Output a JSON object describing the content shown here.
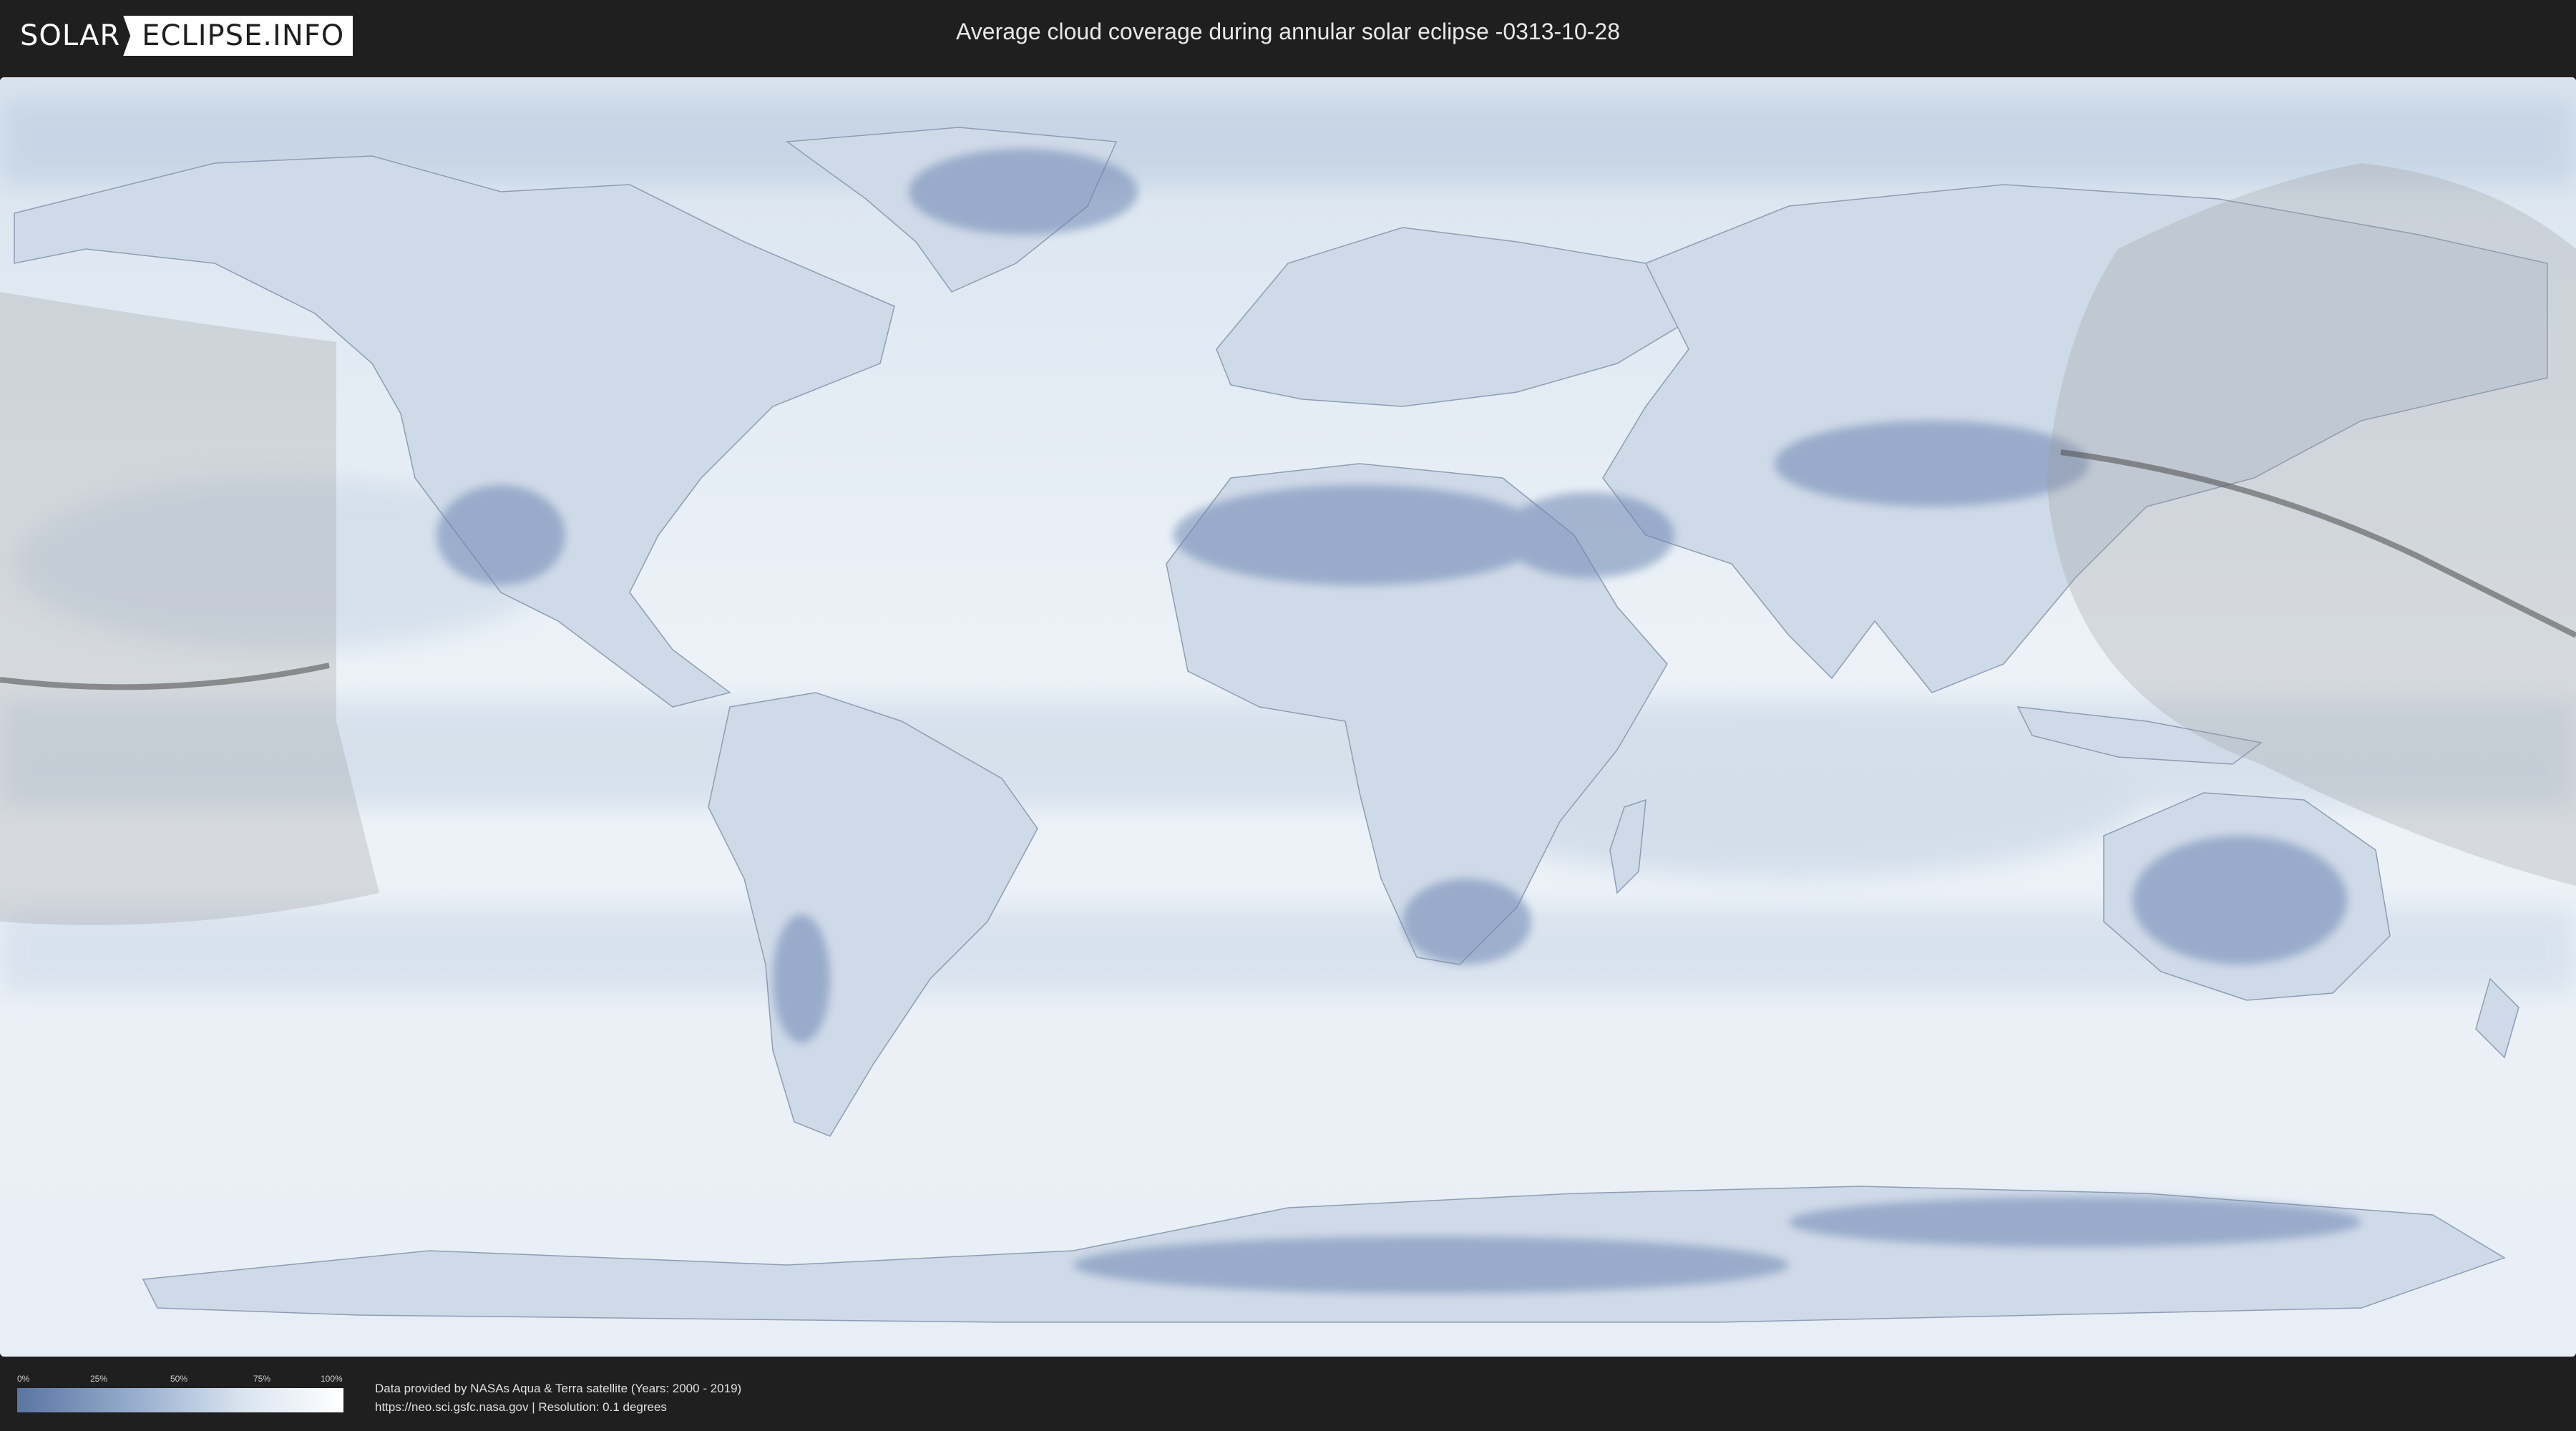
{
  "header": {
    "logo_left": "SOLAR",
    "logo_right": "ECLIPSE.INFO",
    "title": "Average cloud coverage during annular solar eclipse -0313-10-28"
  },
  "legend": {
    "ticks": [
      "0%",
      "25%",
      "50%",
      "75%",
      "100%"
    ],
    "colors": {
      "low": "#5a74a3",
      "high": "#ffffff"
    }
  },
  "credits": {
    "line1": "Data provided by NASAs Aqua & Terra satellite (Years: 2000 - 2019)",
    "line2": "https://neo.sci.gsfc.nasa.gov | Resolution: 0.1 degrees"
  },
  "colors": {
    "background": "#1f1f1f",
    "ocean": "#eef3f8",
    "cloud_dense": "#5a74a3",
    "shadow": "#9a9a9a",
    "path": "#555555"
  }
}
